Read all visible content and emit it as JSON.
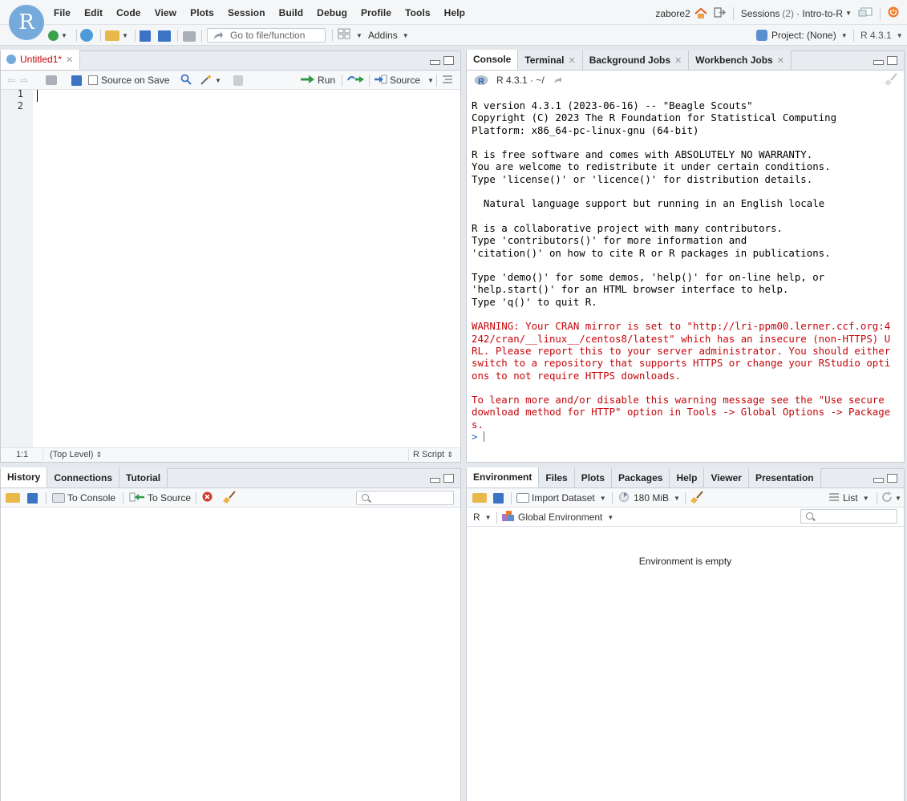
{
  "app": {
    "logo_letter": "R",
    "menus": [
      "File",
      "Edit",
      "Code",
      "View",
      "Plots",
      "Session",
      "Build",
      "Debug",
      "Profile",
      "Tools",
      "Help"
    ],
    "user": "zabore2",
    "sessions_label": "Sessions",
    "sessions_count": "(2)",
    "session_name": "· Intro-to-R",
    "project_label": "Project: (None)",
    "r_version": "R 4.3.1"
  },
  "toolbar": {
    "goto_placeholder": "Go to file/function",
    "addins_label": "Addins"
  },
  "editor": {
    "tab_label": "Untitled1*",
    "source_on_save_label": "Source on Save",
    "run_label": "Run",
    "source_label": "Source",
    "line_numbers": [
      "1",
      "2"
    ],
    "status_position": "1:1",
    "status_scope": "(Top Level)",
    "status_filetype": "R Script"
  },
  "console_pane": {
    "tabs": [
      {
        "label": "Console",
        "closable": false
      },
      {
        "label": "Terminal",
        "closable": true
      },
      {
        "label": "Background Jobs",
        "closable": true
      },
      {
        "label": "Workbench Jobs",
        "closable": true
      }
    ],
    "version_path": "R 4.3.1 · ~/",
    "output_lines": [
      {
        "text": "R version 4.3.1 (2023-06-16) -- \"Beagle Scouts\"",
        "kind": "normal"
      },
      {
        "text": "Copyright (C) 2023 The R Foundation for Statistical Computing",
        "kind": "normal"
      },
      {
        "text": "Platform: x86_64-pc-linux-gnu (64-bit)",
        "kind": "normal"
      },
      {
        "text": "",
        "kind": "normal"
      },
      {
        "text": "R is free software and comes with ABSOLUTELY NO WARRANTY.",
        "kind": "normal"
      },
      {
        "text": "You are welcome to redistribute it under certain conditions.",
        "kind": "normal"
      },
      {
        "text": "Type 'license()' or 'licence()' for distribution details.",
        "kind": "normal"
      },
      {
        "text": "",
        "kind": "normal"
      },
      {
        "text": "  Natural language support but running in an English locale",
        "kind": "normal"
      },
      {
        "text": "",
        "kind": "normal"
      },
      {
        "text": "R is a collaborative project with many contributors.",
        "kind": "normal"
      },
      {
        "text": "Type 'contributors()' for more information and",
        "kind": "normal"
      },
      {
        "text": "'citation()' on how to cite R or R packages in publications.",
        "kind": "normal"
      },
      {
        "text": "",
        "kind": "normal"
      },
      {
        "text": "Type 'demo()' for some demos, 'help()' for on-line help, or",
        "kind": "normal"
      },
      {
        "text": "'help.start()' for an HTML browser interface to help.",
        "kind": "normal"
      },
      {
        "text": "Type 'q()' to quit R.",
        "kind": "normal"
      },
      {
        "text": "",
        "kind": "normal"
      },
      {
        "text": "WARNING: Your CRAN mirror is set to \"http://lri-ppm00.lerner.ccf.org:4",
        "kind": "warn"
      },
      {
        "text": "242/cran/__linux__/centos8/latest\" which has an insecure (non-HTTPS) U",
        "kind": "warn"
      },
      {
        "text": "RL. Please report this to your server administrator. You should either",
        "kind": "warn"
      },
      {
        "text": "switch to a repository that supports HTTPS or change your RStudio opti",
        "kind": "warn"
      },
      {
        "text": "ons to not require HTTPS downloads.",
        "kind": "warn"
      },
      {
        "text": "",
        "kind": "normal"
      },
      {
        "text": "To learn more and/or disable this warning message see the \"Use secure",
        "kind": "warn"
      },
      {
        "text": "download method for HTTP\" option in Tools -> Global Options -> Package",
        "kind": "warn"
      },
      {
        "text": "s.",
        "kind": "warn"
      }
    ],
    "prompt": ">"
  },
  "history_pane": {
    "tabs": [
      "History",
      "Connections",
      "Tutorial"
    ],
    "to_console_label": "To Console",
    "to_source_label": "To Source"
  },
  "env_pane": {
    "tabs": [
      "Environment",
      "Files",
      "Plots",
      "Packages",
      "Help",
      "Viewer",
      "Presentation"
    ],
    "import_dataset_label": "Import Dataset",
    "memory_label": "180 MiB",
    "list_label": "List",
    "language_label": "R",
    "scope_label": "Global Environment",
    "empty_message": "Environment is empty"
  },
  "colors": {
    "accent": "#75aadb",
    "warning_text": "#c5060b",
    "prompt": "#2a64b8"
  }
}
